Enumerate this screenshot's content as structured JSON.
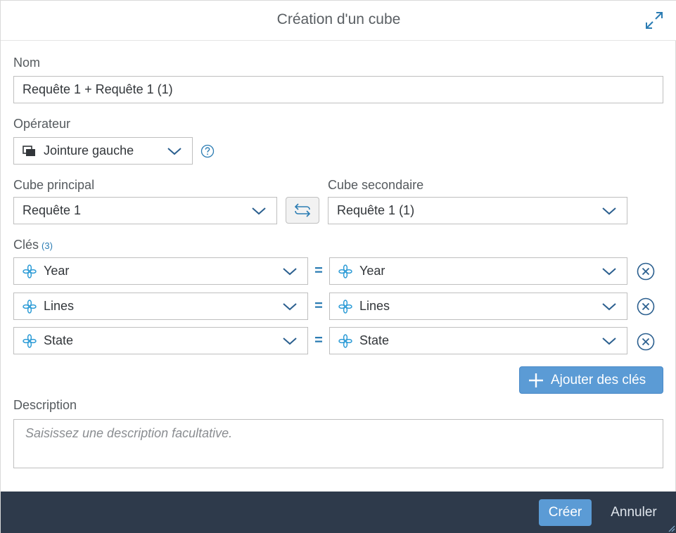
{
  "dialog": {
    "title": "Création d'un cube",
    "maximize_icon": "maximize-icon"
  },
  "name_field": {
    "label": "Nom",
    "value": "Requête 1 + Requête 1 (1)"
  },
  "operator": {
    "label": "Opérateur",
    "value": "Jointure gauche",
    "icon": "left-join-icon",
    "help_icon": "help-icon"
  },
  "main_cube": {
    "label": "Cube principal",
    "value": "Requête 1"
  },
  "secondary_cube": {
    "label": "Cube secondaire",
    "value": "Requête 1 (1)"
  },
  "swap_icon": "swap-icon",
  "keys": {
    "label": "Clés",
    "count": "(3)",
    "rows": [
      {
        "left": "Year",
        "right": "Year",
        "operator": "="
      },
      {
        "left": "Lines",
        "right": "Lines",
        "operator": "="
      },
      {
        "left": "State",
        "right": "State",
        "operator": "="
      }
    ],
    "add_label": "Ajouter des clés"
  },
  "description": {
    "label": "Description",
    "placeholder": "Saisissez une description facultative."
  },
  "footer": {
    "create_label": "Créer",
    "cancel_label": "Annuler"
  },
  "colors": {
    "accent": "#5b9bd5",
    "footer_bg": "#2e3a4b",
    "link": "#2b7cb3"
  }
}
